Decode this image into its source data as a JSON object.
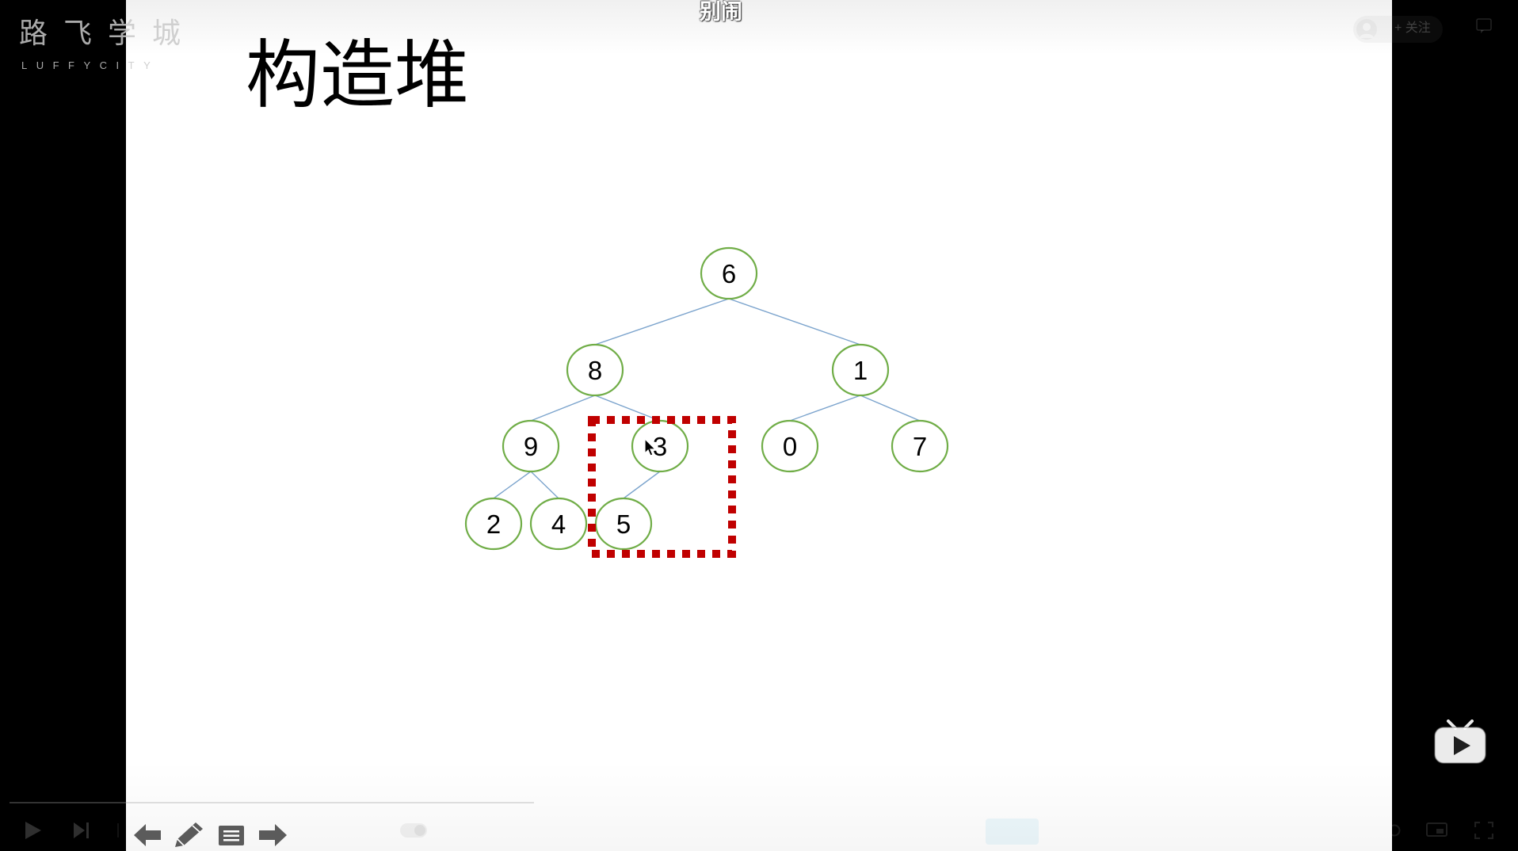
{
  "player": {
    "watermark": {
      "brand_cn": "路飞学城",
      "brand_en": "LUFFYCITY"
    },
    "danmaku": [
      {
        "text": "别闹"
      }
    ],
    "uploader": {
      "follow_label": "+ 关注"
    },
    "progress_fraction": 0.35
  },
  "slide": {
    "title": "构造堆",
    "tree": {
      "root": {
        "label": "6",
        "children": [
          {
            "label": "8",
            "children": [
              {
                "label": "9",
                "children": [
                  {
                    "label": "2"
                  },
                  {
                    "label": "4"
                  }
                ]
              },
              {
                "label": "3",
                "highlighted": true,
                "children": [
                  {
                    "label": "5",
                    "highlighted": true
                  }
                ]
              }
            ]
          },
          {
            "label": "1",
            "children": [
              {
                "label": "0"
              },
              {
                "label": "7"
              }
            ]
          }
        ]
      }
    }
  },
  "colors": {
    "letterbox": "#000000",
    "slide_background": "#ffffff",
    "node_stroke": "#70ad47",
    "node_fill": "#ffffff",
    "edge": "#7ca4cd",
    "highlight_box": "#c00000",
    "slide_icons": "#5b5b5b"
  },
  "icons": {
    "play": "play-icon",
    "next": "next-icon",
    "prev_slide": "arrow-left-icon",
    "pen": "pen-icon",
    "slide_menu": "menu-icon",
    "next_slide": "arrow-right-icon",
    "danmaku_toggle": "toggle-icon",
    "settings": "settings-icon",
    "web_fullscreen": "web-fullscreen-icon",
    "fullscreen": "fullscreen-icon",
    "bilibili": "bilibili-tv-icon",
    "avatar": "avatar-icon",
    "feedback": "feedback-icon",
    "cursor": "mouse-cursor-icon"
  }
}
